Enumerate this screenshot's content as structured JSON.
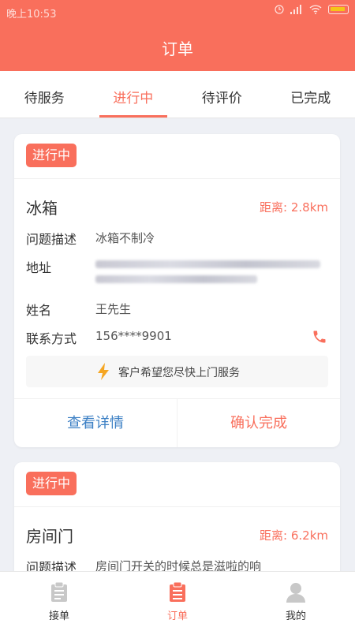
{
  "status_bar": {
    "time": "晚上10:53"
  },
  "header": {
    "title": "订单"
  },
  "tabs": [
    {
      "label": "待服务",
      "active": false
    },
    {
      "label": "进行中",
      "active": true
    },
    {
      "label": "待评价",
      "active": false
    },
    {
      "label": "已完成",
      "active": false
    }
  ],
  "orders": [
    {
      "status": "进行中",
      "item": "冰箱",
      "distance": "距离: 2.8km",
      "problem_label": "问题描述",
      "problem": "冰箱不制冷",
      "address_label": "地址",
      "name_label": "姓名",
      "name": "王先生",
      "contact_label": "联系方式",
      "phone": "156****9901",
      "hint": "客户希望您尽快上门服务",
      "details_button": "查看详情",
      "confirm_button": "确认完成"
    },
    {
      "status": "进行中",
      "item": "房间门",
      "distance": "距离: 6.2km",
      "problem_label": "问题描述",
      "problem": "房间门开关的时候总是滋啦的响"
    }
  ],
  "bottom_nav": [
    {
      "label": "接单",
      "icon": "clipboard-icon",
      "active": false
    },
    {
      "label": "订单",
      "icon": "order-list-icon",
      "active": true
    },
    {
      "label": "我的",
      "icon": "user-icon",
      "active": false
    }
  ],
  "colors": {
    "accent": "#f96f5c",
    "link": "#3b7fc4",
    "background": "#eef0f5"
  }
}
